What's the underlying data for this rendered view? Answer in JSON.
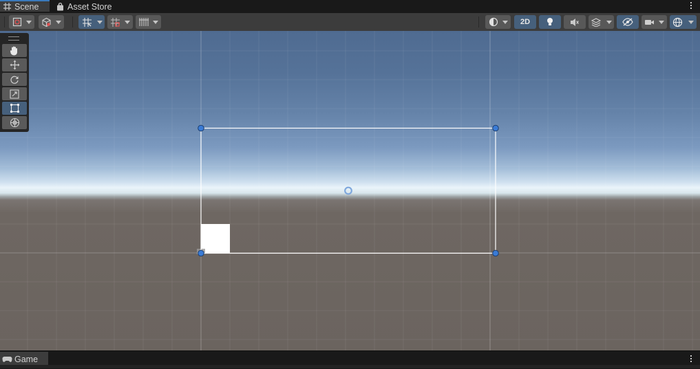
{
  "tabs": {
    "scene_label": "Scene",
    "asset_store_label": "Asset Store",
    "game_label": "Game"
  },
  "toolbar": {
    "mode_2d_label": "2D",
    "mode_2d_active": true,
    "grid_snapping_active": true
  },
  "tool_palette": {
    "tools": [
      "hand-tool",
      "move-tool",
      "rotate-tool",
      "scale-tool",
      "rect-tool",
      "transform-tool"
    ],
    "active_tool": "rect-tool"
  },
  "colors": {
    "accent": "#3a79bb",
    "toolbar_bg": "#3c3c3c",
    "active_button": "#46607c",
    "handle": "#3a7bd5"
  }
}
